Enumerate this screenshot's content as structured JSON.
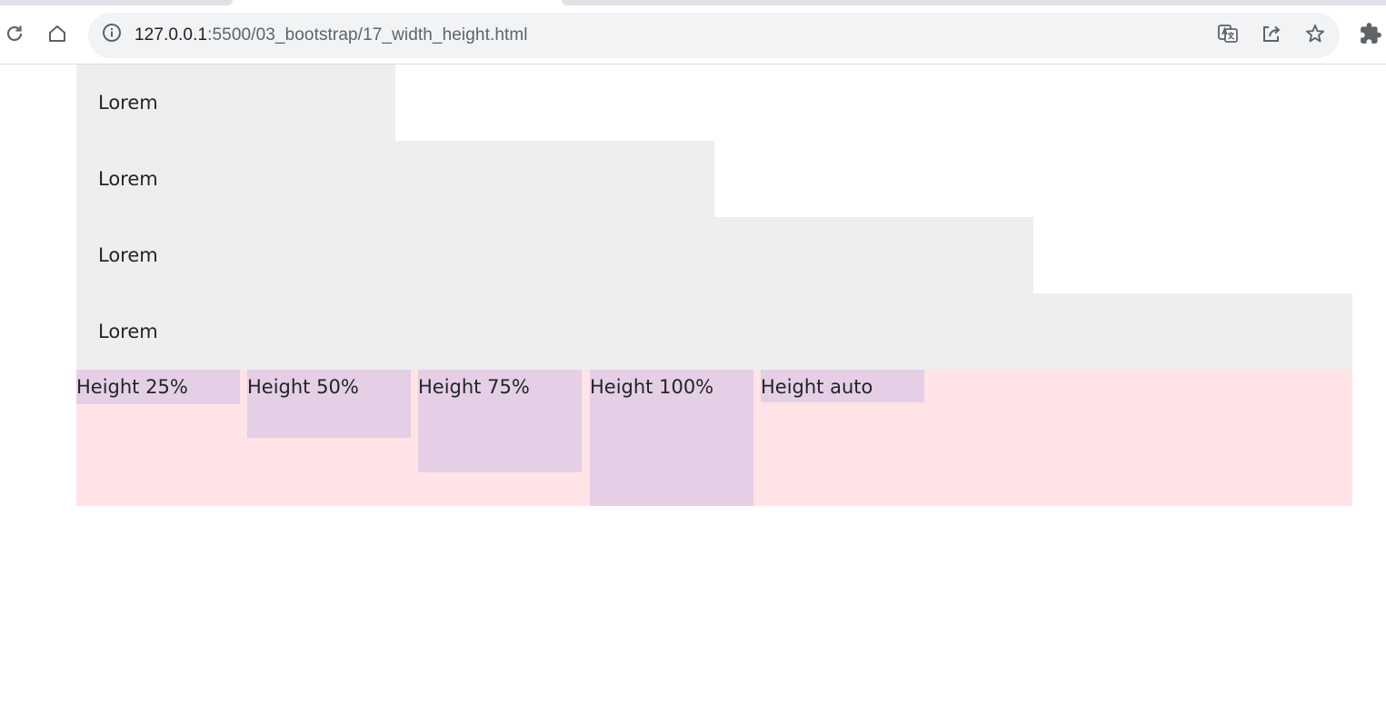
{
  "browser": {
    "url_host": "127.0.0.1",
    "url_path": ":5500/03_bootstrap/17_width_height.html",
    "icons": [
      "reload-icon",
      "home-icon",
      "info-icon",
      "translate-icon",
      "share-icon",
      "star-icon",
      "extensions-icon"
    ]
  },
  "content": {
    "width_rows": [
      {
        "label": "Lorem",
        "width_percent": 25
      },
      {
        "label": "Lorem",
        "width_percent": 50
      },
      {
        "label": "Lorem",
        "width_percent": 75
      },
      {
        "label": "Lorem",
        "width_percent": 100
      }
    ],
    "height_boxes": [
      {
        "label": "Height 25%",
        "height_percent": 25
      },
      {
        "label": "Height 50%",
        "height_percent": 50
      },
      {
        "label": "Height 75%",
        "height_percent": 75
      },
      {
        "label": "Height 100%",
        "height_percent": 100
      },
      {
        "label": "Height auto",
        "height_percent": null
      }
    ]
  },
  "colors": {
    "width_row_bg": "#eeeeee",
    "height_container_bg": "#ffe3e6",
    "height_box_bg": "#e5cfe6"
  }
}
